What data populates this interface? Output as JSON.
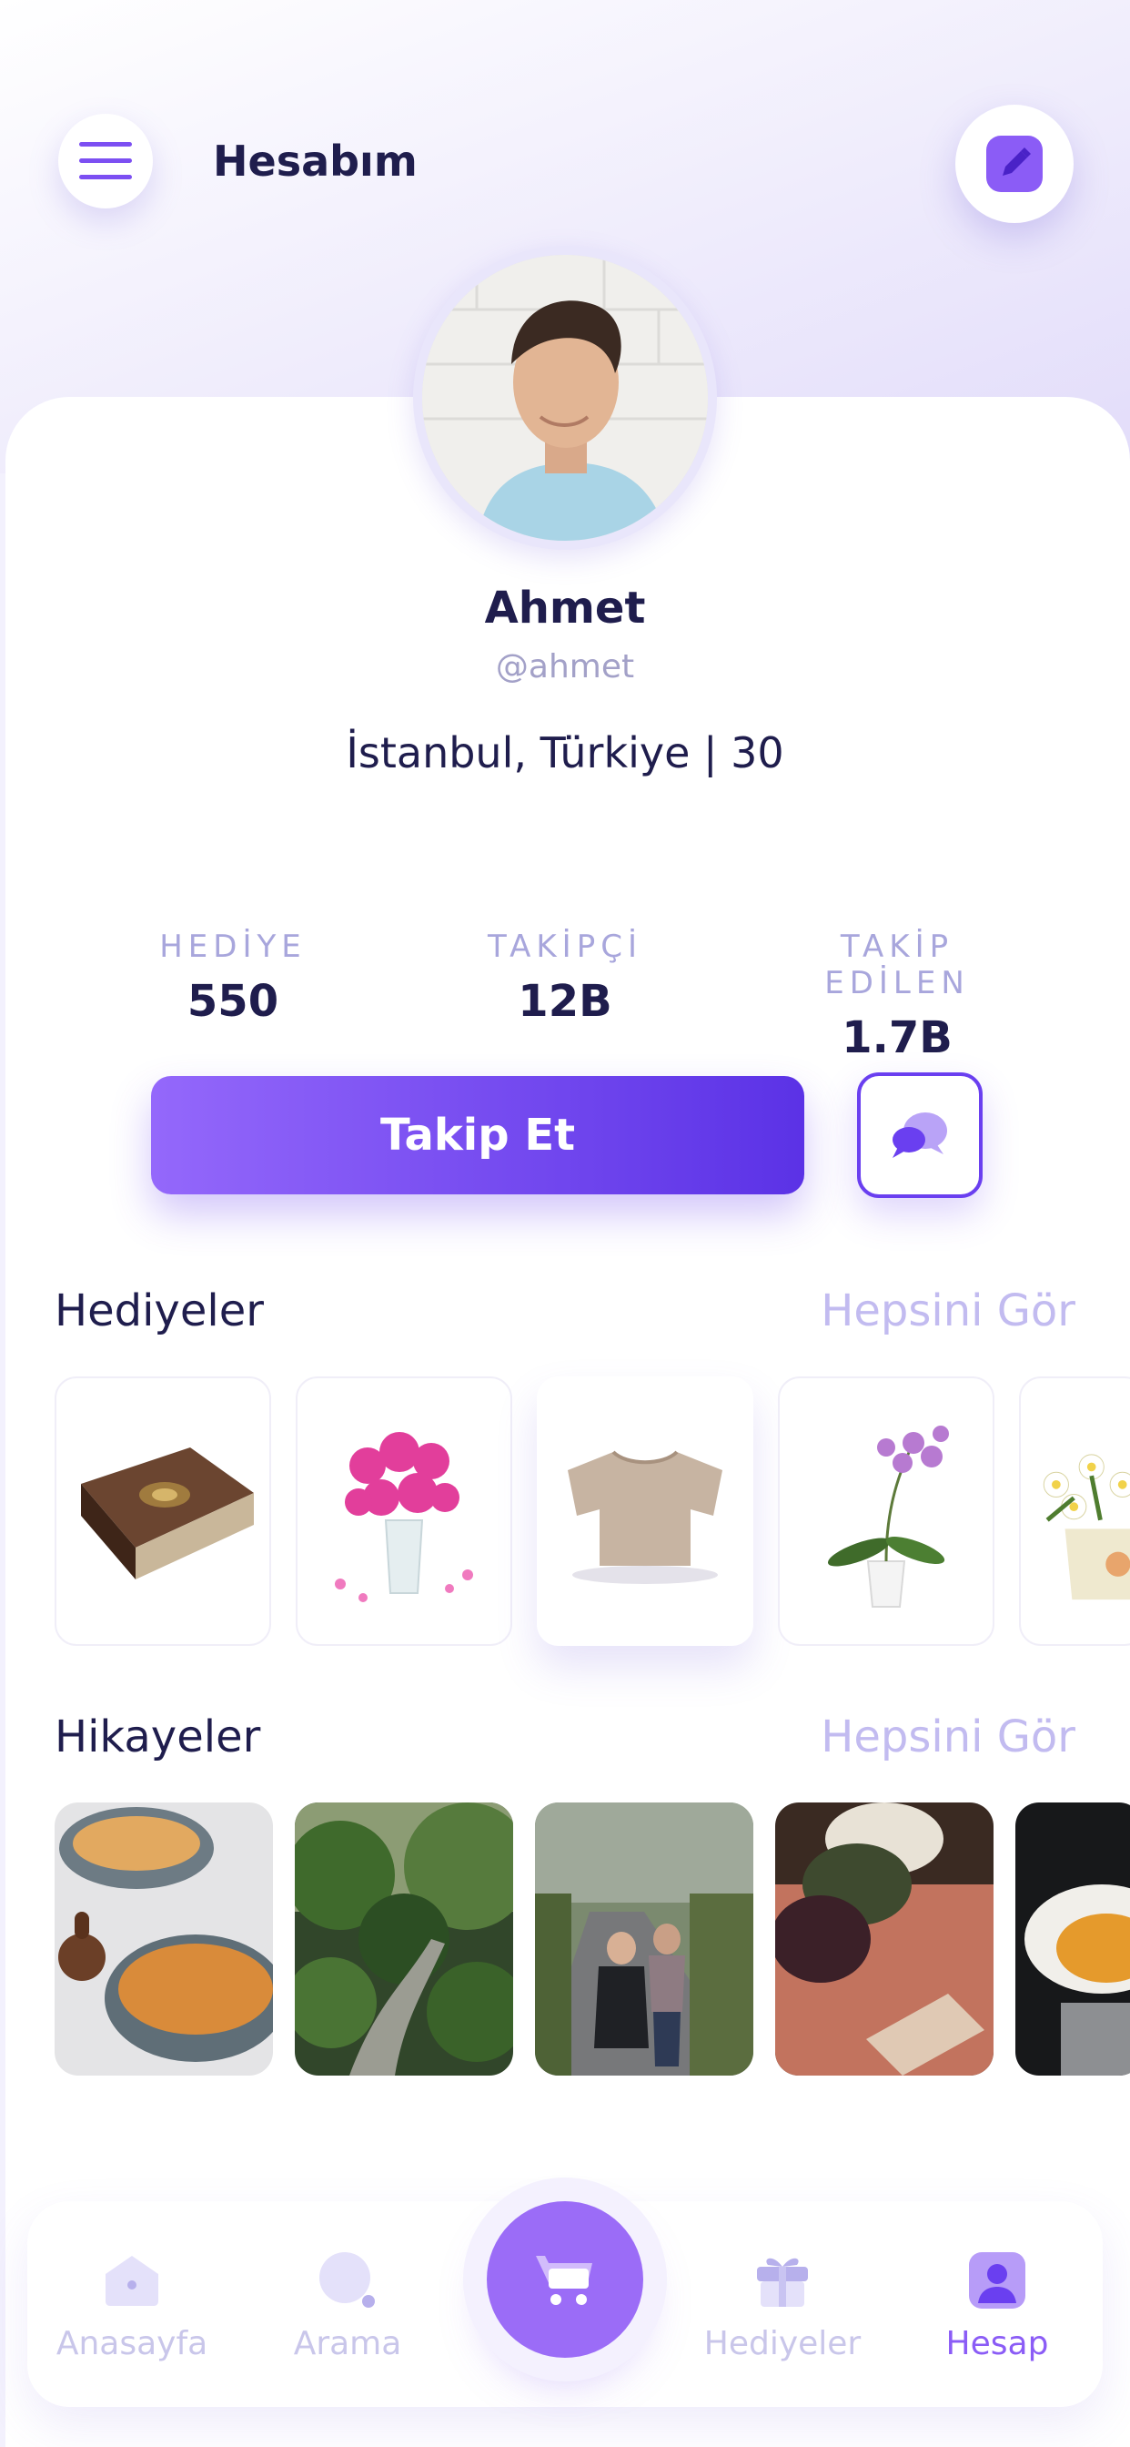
{
  "header": {
    "title": "Hesabım"
  },
  "profile": {
    "name": "Ahmet",
    "handle": "@ahmet",
    "location": "İstanbul, Türkiye | 30"
  },
  "stats": [
    {
      "label": "HEDİYE",
      "value": "550"
    },
    {
      "label": "TAKİPÇİ",
      "value": "12B"
    },
    {
      "label": "TAKİP EDİLEN",
      "value": "1.7B"
    }
  ],
  "actions": {
    "follow_label": "Takip Et"
  },
  "gifts_section": {
    "title": "Hediyeler",
    "see_all": "Hepsini Gör",
    "items": [
      {
        "icon": "book-icon"
      },
      {
        "icon": "flower-bouquet-icon"
      },
      {
        "icon": "tshirt-icon"
      },
      {
        "icon": "orchid-icon"
      },
      {
        "icon": "plant-pot-icon"
      }
    ]
  },
  "stories_section": {
    "title": "Hikayeler",
    "see_all": "Hepsini Gör"
  },
  "bottom_nav": {
    "items": [
      {
        "label": "Anasayfa",
        "icon": "home-icon"
      },
      {
        "label": "Arama",
        "icon": "search-icon"
      },
      {
        "label": "",
        "icon": "cart-icon"
      },
      {
        "label": "Hediyeler",
        "icon": "gift-icon"
      },
      {
        "label": "Hesap",
        "icon": "user-icon"
      }
    ],
    "active": "Hesap"
  },
  "colors": {
    "accent": "#8b5cf6",
    "accent_dark": "#5b32e6",
    "text": "#1f1d4d",
    "muted": "#a8a6dc"
  }
}
